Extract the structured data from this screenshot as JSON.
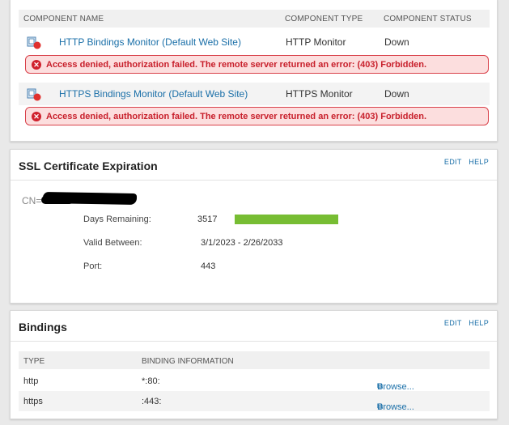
{
  "components": {
    "headers": {
      "name": "COMPONENT NAME",
      "type": "COMPONENT TYPE",
      "status": "COMPONENT STATUS"
    },
    "rows": [
      {
        "name": "HTTP Bindings Monitor (Default Web Site)",
        "type": "HTTP Monitor",
        "status": "Down",
        "error": "Access denied, authorization failed. The remote server returned an error: (403) Forbidden."
      },
      {
        "name": "HTTPS Bindings Monitor (Default Web Site)",
        "type": "HTTPS Monitor",
        "status": "Down",
        "error": "Access denied, authorization failed. The remote server returned an error: (403) Forbidden."
      }
    ],
    "colors": {
      "status_down": "#e0302d",
      "error_border": "#d9414a",
      "error_bg": "#fcdede"
    }
  },
  "ssl": {
    "title": "SSL Certificate Expiration",
    "edit": "EDIT",
    "help": "HELP",
    "cn_prefix": "CN=",
    "days_label": "Days Remaining:",
    "days_value": "3517",
    "days_bar_fraction": 1.0,
    "valid_label": "Valid Between:",
    "valid_value": "3/1/2023 - 2/26/2033",
    "port_label": "Port:",
    "port_value": "443",
    "bar_color": "#77bd33"
  },
  "bindings": {
    "title": "Bindings",
    "edit": "EDIT",
    "help": "HELP",
    "headers": {
      "type": "TYPE",
      "info": "BINDING INFORMATION"
    },
    "rows": [
      {
        "type": "http",
        "info": "*:80:",
        "browse": "Browse..."
      },
      {
        "type": "https",
        "info": ":443:",
        "browse": "Browse..."
      }
    ]
  }
}
